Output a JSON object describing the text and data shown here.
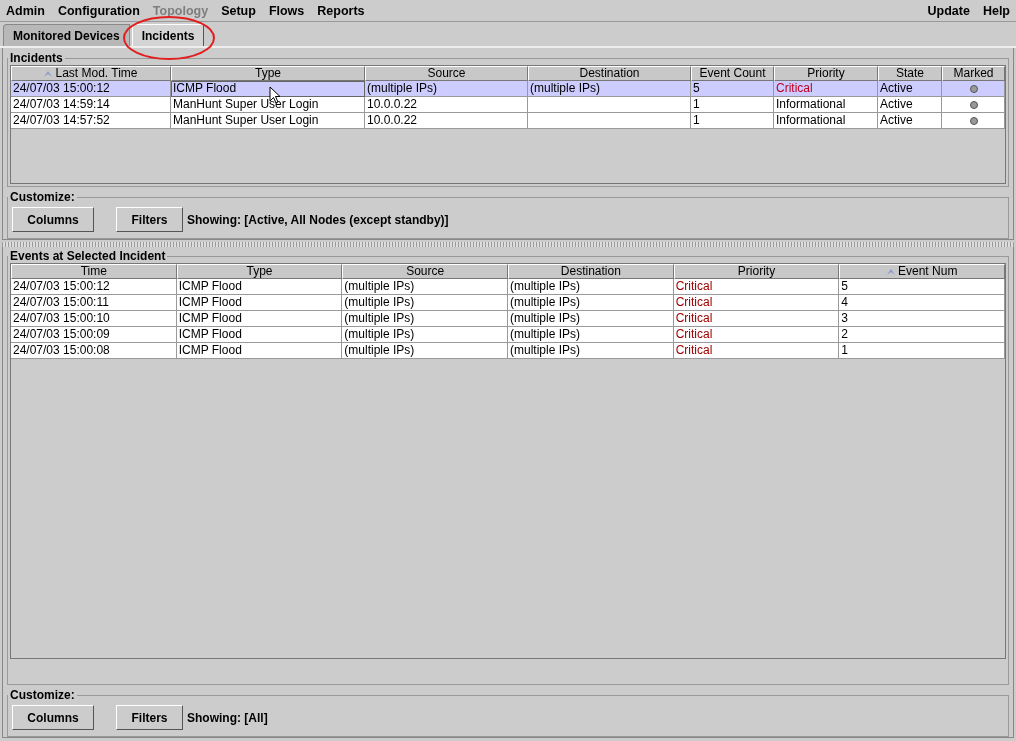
{
  "menu": {
    "left": [
      {
        "label": "Admin",
        "disabled": false
      },
      {
        "label": "Configuration",
        "disabled": false
      },
      {
        "label": "Topology",
        "disabled": true
      },
      {
        "label": "Setup",
        "disabled": false
      },
      {
        "label": "Flows",
        "disabled": false
      },
      {
        "label": "Reports",
        "disabled": false
      }
    ],
    "right": [
      {
        "label": "Update",
        "disabled": false
      },
      {
        "label": "Help",
        "disabled": false
      }
    ]
  },
  "tabs": [
    {
      "label": "Monitored Devices",
      "selected": false,
      "circled": false
    },
    {
      "label": "Incidents",
      "selected": true,
      "circled": true
    }
  ],
  "incidents": {
    "title": "Incidents",
    "columns": [
      {
        "label": "Last Mod. Time",
        "sorted": true
      },
      {
        "label": "Type",
        "sorted": false
      },
      {
        "label": "Source",
        "sorted": false
      },
      {
        "label": "Destination",
        "sorted": false
      },
      {
        "label": "Event Count",
        "sorted": false
      },
      {
        "label": "Priority",
        "sorted": false
      },
      {
        "label": "State",
        "sorted": false
      },
      {
        "label": "Marked",
        "sorted": false
      }
    ],
    "rows": [
      {
        "selected": true,
        "time": "24/07/03 15:00:12",
        "type": "ICMP Flood",
        "source": "(multiple IPs)",
        "destination": "(multiple IPs)",
        "count": "5",
        "priority": "Critical",
        "color": "#c00020",
        "state": "Active",
        "marked": false
      },
      {
        "selected": false,
        "time": "24/07/03 14:59:14",
        "type": "ManHunt Super User Login",
        "source": "10.0.0.22",
        "destination": "",
        "count": "1",
        "priority": "Informational",
        "color": "#000000",
        "state": "Active",
        "marked": false
      },
      {
        "selected": false,
        "time": "24/07/03 14:57:52",
        "type": "ManHunt Super User Login",
        "source": "10.0.0.22",
        "destination": "",
        "count": "1",
        "priority": "Informational",
        "color": "#000000",
        "state": "Active",
        "marked": false
      }
    ],
    "customize": {
      "title": "Customize:",
      "buttons": [
        "Columns",
        "Filters"
      ],
      "showing": "Showing: [Active, All Nodes (except standby)]"
    }
  },
  "events": {
    "title": "Events at Selected Incident",
    "columns": [
      {
        "label": "Time",
        "sorted": false
      },
      {
        "label": "Type",
        "sorted": false
      },
      {
        "label": "Source",
        "sorted": false
      },
      {
        "label": "Destination",
        "sorted": false
      },
      {
        "label": "Priority",
        "sorted": false
      },
      {
        "label": "Event Num",
        "sorted": true
      }
    ],
    "rows": [
      {
        "time": "24/07/03 15:00:12",
        "type": "ICMP Flood",
        "source": "(multiple IPs)",
        "destination": "(multiple IPs)",
        "priority": "Critical",
        "color": "#a00000",
        "num": "5"
      },
      {
        "time": "24/07/03 15:00:11",
        "type": "ICMP Flood",
        "source": "(multiple IPs)",
        "destination": "(multiple IPs)",
        "priority": "Critical",
        "color": "#a00000",
        "num": "4"
      },
      {
        "time": "24/07/03 15:00:10",
        "type": "ICMP Flood",
        "source": "(multiple IPs)",
        "destination": "(multiple IPs)",
        "priority": "Critical",
        "color": "#a00000",
        "num": "3"
      },
      {
        "time": "24/07/03 15:00:09",
        "type": "ICMP Flood",
        "source": "(multiple IPs)",
        "destination": "(multiple IPs)",
        "priority": "Critical",
        "color": "#a00000",
        "num": "2"
      },
      {
        "time": "24/07/03 15:00:08",
        "type": "ICMP Flood",
        "source": "(multiple IPs)",
        "destination": "(multiple IPs)",
        "priority": "Critical",
        "color": "#a00000",
        "num": "1"
      }
    ],
    "customize": {
      "title": "Customize:",
      "buttons": [
        "Columns",
        "Filters"
      ],
      "showing": "Showing: [All]"
    }
  }
}
